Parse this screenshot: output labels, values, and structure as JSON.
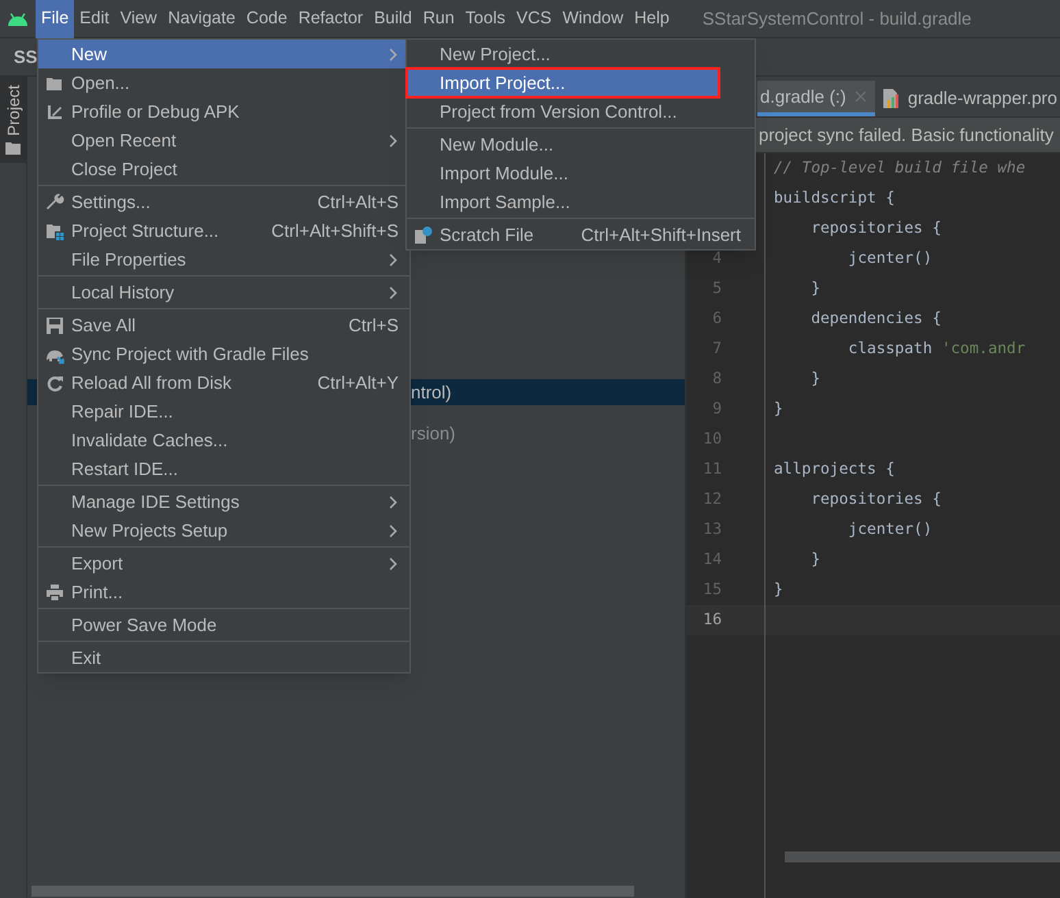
{
  "menubar": {
    "items": [
      {
        "label": "File",
        "selected": true
      },
      {
        "label": "Edit",
        "selected": false
      },
      {
        "label": "View",
        "selected": false
      },
      {
        "label": "Navigate",
        "selected": false
      },
      {
        "label": "Code",
        "selected": false
      },
      {
        "label": "Refactor",
        "selected": false
      },
      {
        "label": "Build",
        "selected": false
      },
      {
        "label": "Run",
        "selected": false
      },
      {
        "label": "Tools",
        "selected": false
      },
      {
        "label": "VCS",
        "selected": false
      },
      {
        "label": "Window",
        "selected": false
      },
      {
        "label": "Help",
        "selected": false
      }
    ]
  },
  "window": {
    "title": "SStarSystemControl - build.gradle"
  },
  "toolbar": {
    "project_name": "SS"
  },
  "tool_window_tab": {
    "label": "Project"
  },
  "project_tree": {
    "rows": [
      {
        "text": "ntrol)",
        "selected": true
      },
      {
        "text": "rsion)",
        "selected": false
      }
    ]
  },
  "editor_tabs": [
    {
      "label": "d.gradle (:)",
      "selected": true,
      "closable": true
    },
    {
      "label": "gradle-wrapper.pro",
      "selected": false,
      "closable": false
    }
  ],
  "notification": {
    "text": "project sync failed. Basic functionality"
  },
  "code_lines": [
    {
      "segments": [
        {
          "text": "// Top-level build file whe",
          "kind": "comment"
        }
      ]
    },
    {
      "segments": [
        {
          "text": "buildscript {",
          "kind": "plain"
        }
      ]
    },
    {
      "segments": [
        {
          "text": "    repositories {",
          "kind": "plain"
        }
      ]
    },
    {
      "number": "4",
      "segments": [
        {
          "text": "        jcenter()",
          "kind": "plain"
        }
      ],
      "current": false
    },
    {
      "number": "5",
      "segments": [
        {
          "text": "    }",
          "kind": "plain"
        }
      ],
      "current": false
    },
    {
      "number": "6",
      "segments": [
        {
          "text": "    dependencies {",
          "kind": "plain"
        }
      ],
      "current": false
    },
    {
      "number": "7",
      "segments": [
        {
          "text": "        classpath ",
          "kind": "plain"
        },
        {
          "text": "'com.andr",
          "kind": "string"
        }
      ],
      "current": false
    },
    {
      "number": "8",
      "segments": [
        {
          "text": "    }",
          "kind": "plain"
        }
      ],
      "current": false
    },
    {
      "number": "9",
      "segments": [
        {
          "text": "}",
          "kind": "plain"
        }
      ],
      "current": false
    },
    {
      "number": "10",
      "current": false
    },
    {
      "number": "11",
      "segments": [
        {
          "text": "allprojects {",
          "kind": "plain"
        }
      ],
      "current": false
    },
    {
      "number": "12",
      "segments": [
        {
          "text": "    repositories {",
          "kind": "plain"
        }
      ],
      "current": false
    },
    {
      "number": "13",
      "segments": [
        {
          "text": "        jcenter()",
          "kind": "plain"
        }
      ],
      "current": false
    },
    {
      "number": "14",
      "segments": [
        {
          "text": "    }",
          "kind": "plain"
        }
      ],
      "current": false
    },
    {
      "number": "15",
      "segments": [
        {
          "text": "}",
          "kind": "plain"
        }
      ],
      "current": false
    },
    {
      "number": "16",
      "current": true
    }
  ],
  "file_menu": {
    "sections": [
      [
        {
          "label": "New",
          "submenu": true,
          "selected": true
        },
        {
          "label": "Open...",
          "submenu": false,
          "selected": false
        },
        {
          "label": "Profile or Debug APK",
          "submenu": false,
          "selected": false
        },
        {
          "label": "Open Recent",
          "submenu": true,
          "selected": false
        },
        {
          "label": "Close Project",
          "submenu": false,
          "selected": false
        }
      ],
      [
        {
          "label": "Settings...",
          "shortcut": "Ctrl+Alt+S",
          "submenu": false,
          "selected": false
        },
        {
          "label": "Project Structure...",
          "shortcut": "Ctrl+Alt+Shift+S",
          "submenu": false,
          "selected": false
        },
        {
          "label": "File Properties",
          "submenu": true,
          "selected": false
        }
      ],
      [
        {
          "label": "Local History",
          "submenu": true,
          "selected": false
        }
      ],
      [
        {
          "label": "Save All",
          "shortcut": "Ctrl+S",
          "submenu": false,
          "selected": false
        },
        {
          "label": "Sync Project with Gradle Files",
          "submenu": false,
          "selected": false
        },
        {
          "label": "Reload All from Disk",
          "shortcut": "Ctrl+Alt+Y",
          "submenu": false,
          "selected": false
        },
        {
          "label": "Repair IDE...",
          "submenu": false,
          "selected": false
        },
        {
          "label": "Invalidate Caches...",
          "submenu": false,
          "selected": false
        },
        {
          "label": "Restart IDE...",
          "submenu": false,
          "selected": false
        }
      ],
      [
        {
          "label": "Manage IDE Settings",
          "submenu": true,
          "selected": false
        },
        {
          "label": "New Projects Setup",
          "submenu": true,
          "selected": false
        }
      ],
      [
        {
          "label": "Export",
          "submenu": true,
          "selected": false
        },
        {
          "label": "Print...",
          "submenu": false,
          "selected": false
        }
      ],
      [
        {
          "label": "Power Save Mode",
          "submenu": false,
          "selected": false
        }
      ],
      [
        {
          "label": "Exit",
          "submenu": false,
          "selected": false
        }
      ]
    ]
  },
  "new_submenu": {
    "sections": [
      [
        {
          "label": "New Project...",
          "selected": false,
          "outlined": false
        },
        {
          "label": "Import Project...",
          "selected": true,
          "outlined": true
        },
        {
          "label": "Project from Version Control...",
          "selected": false,
          "outlined": false
        }
      ],
      [
        {
          "label": "New Module...",
          "selected": false,
          "outlined": false
        },
        {
          "label": "Import Module...",
          "selected": false,
          "outlined": false
        },
        {
          "label": "Import Sample...",
          "selected": false,
          "outlined": false
        }
      ],
      [
        {
          "label": "Scratch File",
          "shortcut": "Ctrl+Alt+Shift+Insert",
          "selected": false,
          "outlined": false
        }
      ]
    ]
  }
}
